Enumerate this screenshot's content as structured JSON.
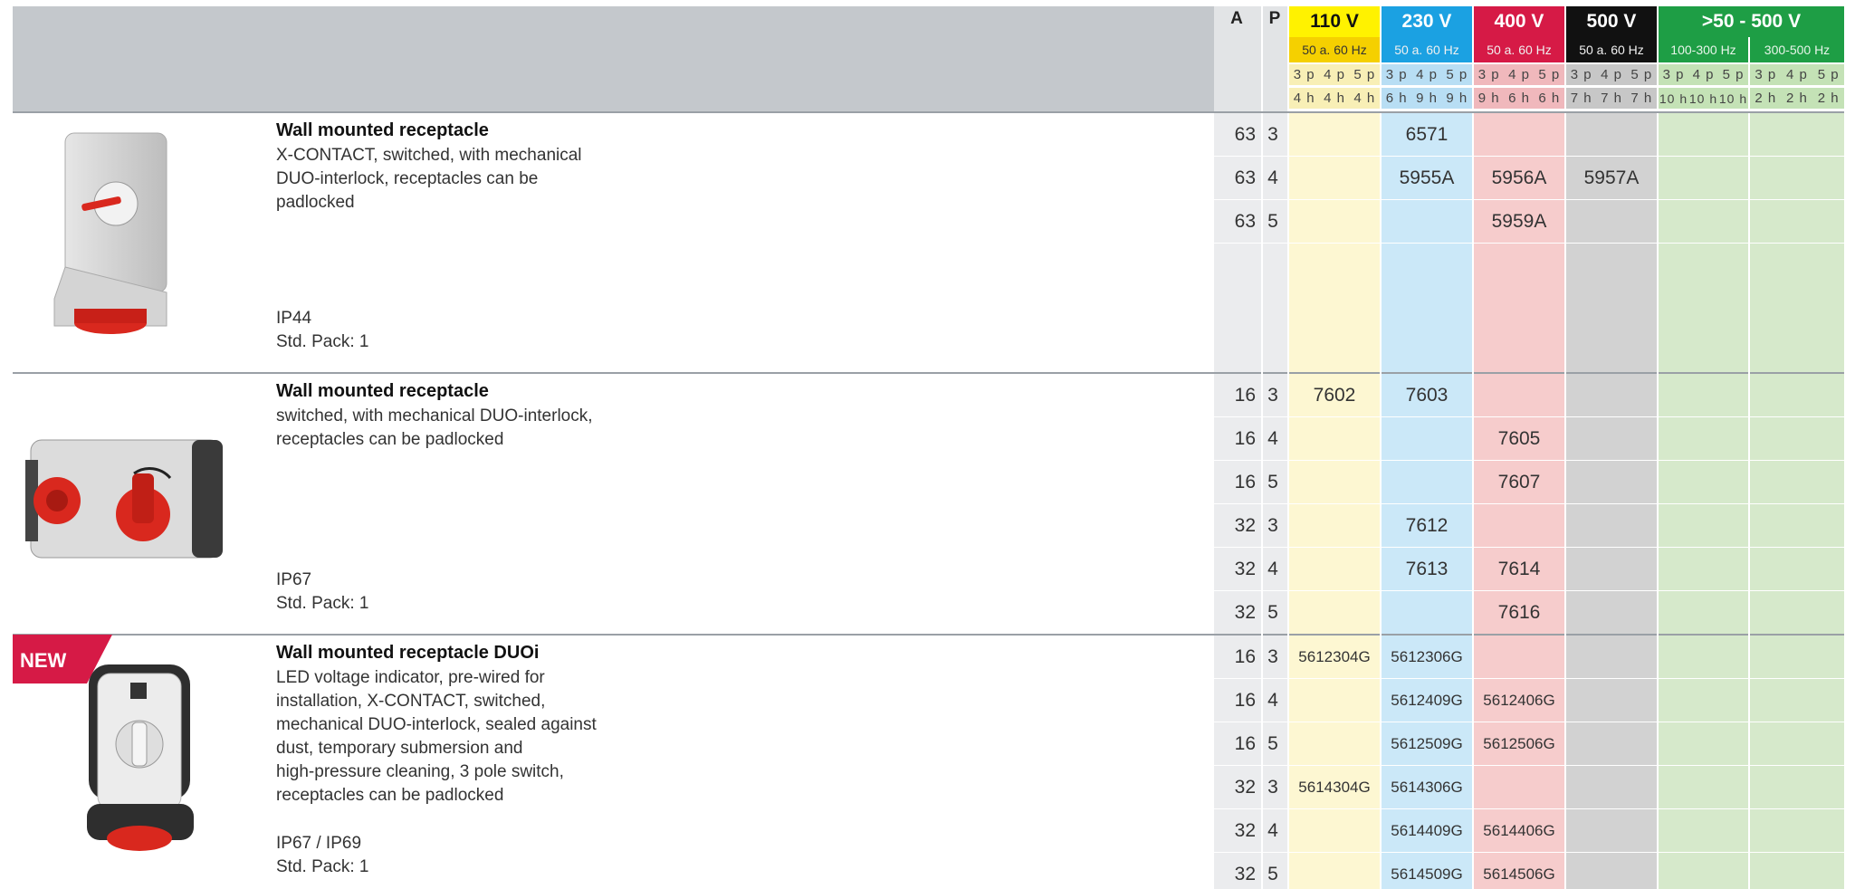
{
  "header": {
    "col_a": "A",
    "col_p": "P",
    "voltages": [
      {
        "label": "110 V",
        "hz": "50 a. 60 Hz",
        "bg": "#fff200",
        "text": "#111111",
        "hz_bg": "#f5d000"
      },
      {
        "label": "230 V",
        "hz": "50 a. 60 Hz",
        "bg": "#1ba1e2",
        "text": "#ffffff",
        "hz_bg": "#1ba1e2"
      },
      {
        "label": "400 V",
        "hz": "50 a. 60 Hz",
        "bg": "#d61a46",
        "text": "#ffffff",
        "hz_bg": "#d61a46"
      },
      {
        "label": "500 V",
        "hz": "50 a. 60 Hz",
        "bg": "#111111",
        "text": "#ffffff",
        "hz_bg": "#111111"
      },
      {
        "label": ">50 - 500 V",
        "bg": "#1e9e45",
        "text": "#ffffff"
      }
    ],
    "hz_green": [
      "100-300 Hz",
      "300-500 Hz"
    ],
    "poles_row": [
      "3 p",
      "4 p",
      "5 p",
      "3 p",
      "4 p",
      "5 p",
      "3 p",
      "4 p",
      "5 p",
      "3 p",
      "4 p",
      "5 p",
      "3 p",
      "4 p",
      "5 p",
      "3 p",
      "4 p",
      "5 p"
    ],
    "hours_row": [
      "4 h",
      "4 h",
      "4 h",
      "6 h",
      "9 h",
      "9 h",
      "9 h",
      "6 h",
      "6 h",
      "7 h",
      "7 h",
      "7 h",
      "10 h",
      "10 h",
      "10 h",
      "2 h",
      "2 h",
      "2 h"
    ]
  },
  "colors": {
    "yellow_col": "#fdf7d2",
    "blue_col": "#cbe8f8",
    "red_col": "#f6cccc",
    "gray_col": "#d2d2d2",
    "green_col": "#d6e9cb",
    "ap_col": "#ebecee",
    "sub_yellow": "#f8efb6",
    "sub_blue": "#b8def4",
    "sub_red": "#f0b8bc",
    "sub_gray": "#c7c7c7",
    "sub_green": "#c4e2b6",
    "new_badge": "#d61a46"
  },
  "products": [
    {
      "title": "Wall mounted receptacle",
      "description": [
        "X-CONTACT, switched, with mechanical",
        "DUO-interlock, receptacles can be",
        "padlocked"
      ],
      "ip": "IP44",
      "pack": "Std. Pack: 1",
      "rows": [
        {
          "a": "63",
          "p": "3",
          "v110": "",
          "v230": "6571",
          "v400": "",
          "v500": ""
        },
        {
          "a": "63",
          "p": "4",
          "v110": "",
          "v230": "5955A",
          "v400": "5956A",
          "v500": "5957A"
        },
        {
          "a": "63",
          "p": "5",
          "v110": "",
          "v230": "",
          "v400": "5959A",
          "v500": ""
        }
      ]
    },
    {
      "title": "Wall mounted receptacle",
      "description": [
        "switched, with mechanical DUO-interlock,",
        "receptacles can be padlocked"
      ],
      "ip": "IP67",
      "pack": "Std. Pack: 1",
      "rows": [
        {
          "a": "16",
          "p": "3",
          "v110": "7602",
          "v230": "7603",
          "v400": "",
          "v500": ""
        },
        {
          "a": "16",
          "p": "4",
          "v110": "",
          "v230": "",
          "v400": "7605",
          "v500": ""
        },
        {
          "a": "16",
          "p": "5",
          "v110": "",
          "v230": "",
          "v400": "7607",
          "v500": ""
        },
        {
          "a": "32",
          "p": "3",
          "v110": "",
          "v230": "7612",
          "v400": "",
          "v500": ""
        },
        {
          "a": "32",
          "p": "4",
          "v110": "",
          "v230": "7613",
          "v400": "7614",
          "v500": ""
        },
        {
          "a": "32",
          "p": "5",
          "v110": "",
          "v230": "",
          "v400": "7616",
          "v500": ""
        }
      ]
    },
    {
      "badge": "NEW",
      "title": "Wall mounted receptacle DUOi",
      "description": [
        "LED voltage indicator, pre-wired for",
        "installation, X-CONTACT, switched,",
        "mechanical DUO-interlock, sealed against",
        "dust, temporary submersion and",
        "high-pressure cleaning, 3 pole switch,",
        "receptacles can be padlocked"
      ],
      "ip": "IP67 / IP69",
      "pack": "Std. Pack: 1",
      "rows": [
        {
          "a": "16",
          "p": "3",
          "v110": "5612304G",
          "v230": "5612306G",
          "v400": "",
          "v500": ""
        },
        {
          "a": "16",
          "p": "4",
          "v110": "",
          "v230": "5612409G",
          "v400": "5612406G",
          "v500": ""
        },
        {
          "a": "16",
          "p": "5",
          "v110": "",
          "v230": "5612509G",
          "v400": "5612506G",
          "v500": ""
        },
        {
          "a": "32",
          "p": "3",
          "v110": "5614304G",
          "v230": "5614306G",
          "v400": "",
          "v500": ""
        },
        {
          "a": "32",
          "p": "4",
          "v110": "",
          "v230": "5614409G",
          "v400": "5614406G",
          "v500": ""
        },
        {
          "a": "32",
          "p": "5",
          "v110": "",
          "v230": "5614509G",
          "v400": "5614506G",
          "v500": ""
        }
      ]
    }
  ]
}
